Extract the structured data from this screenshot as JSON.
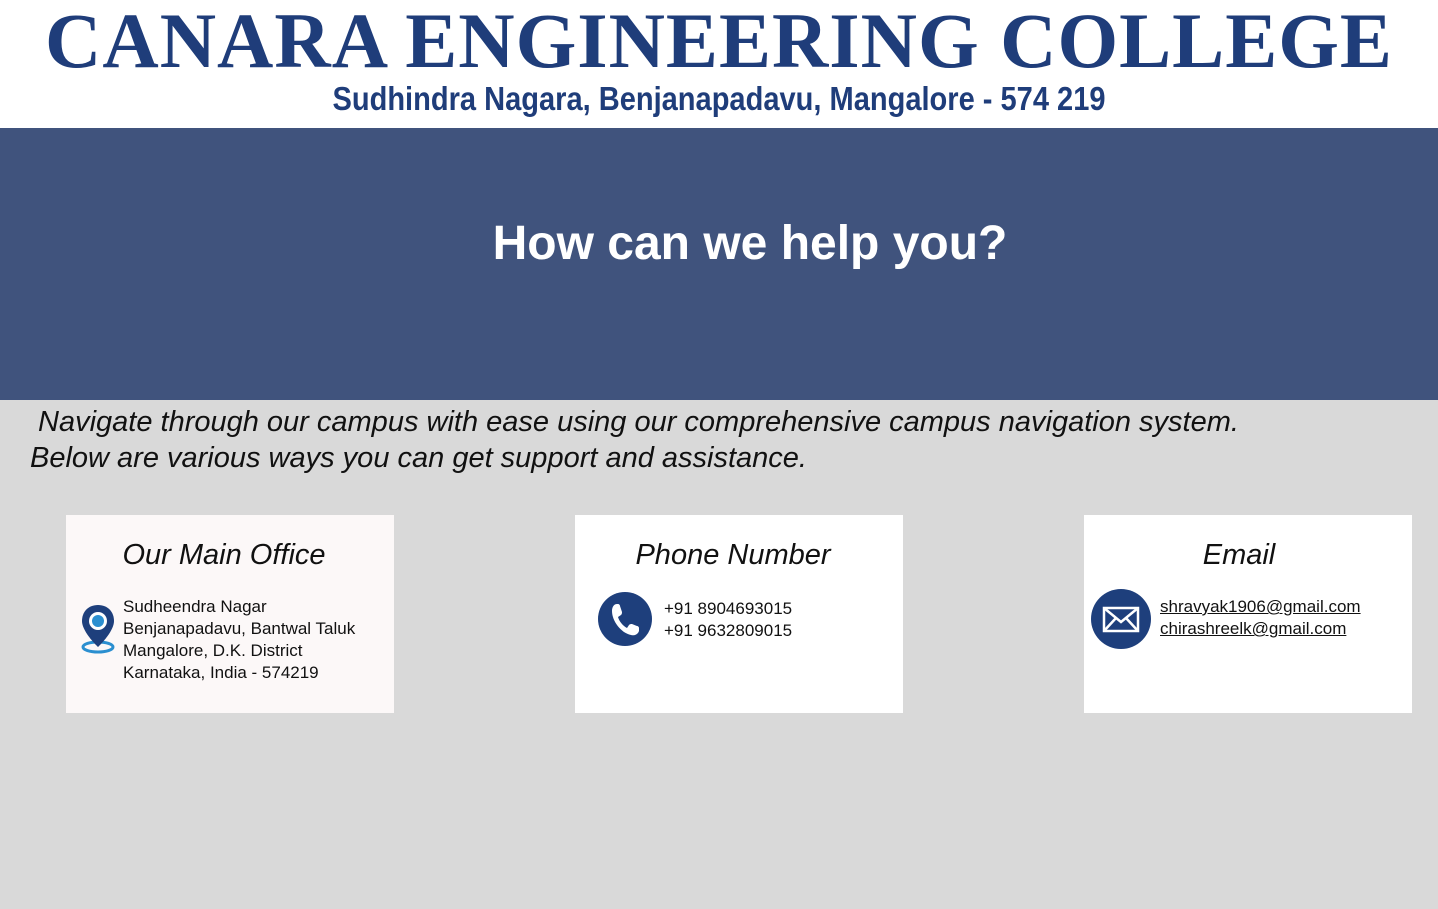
{
  "banner": {
    "title": "CANARA ENGINEERING COLLEGE",
    "subtitle": "Sudhindra Nagara, Benjanapadavu, Mangalore - 574 219"
  },
  "hero": {
    "title": "How can we help you?"
  },
  "intro": {
    "text": "Navigate through our campus with ease using our comprehensive campus navigation system. Below are various ways you can get support and assistance."
  },
  "cards": {
    "office": {
      "title": "Our Main Office",
      "icon": "location-pin-icon",
      "lines": [
        "Sudheendra Nagar",
        "Benjanapadavu, Bantwal Taluk",
        "Mangalore, D.K. District",
        "Karnataka, India - 574219"
      ]
    },
    "phone": {
      "title": "Phone Number",
      "icon": "phone-icon",
      "lines": [
        "+91 8904693015",
        "+91 9632809015"
      ]
    },
    "email": {
      "title": "Email",
      "icon": "envelope-icon",
      "lines": [
        "shravyak1906@gmail.com",
        "chirashreelk@gmail.com"
      ]
    }
  },
  "colors": {
    "brand_navy": "#1f3d7a",
    "hero_bg": "#40537d",
    "page_bg": "#d9d9d9",
    "icon_blue": "#1e3f7c",
    "pin_accent": "#2b8fd0"
  }
}
